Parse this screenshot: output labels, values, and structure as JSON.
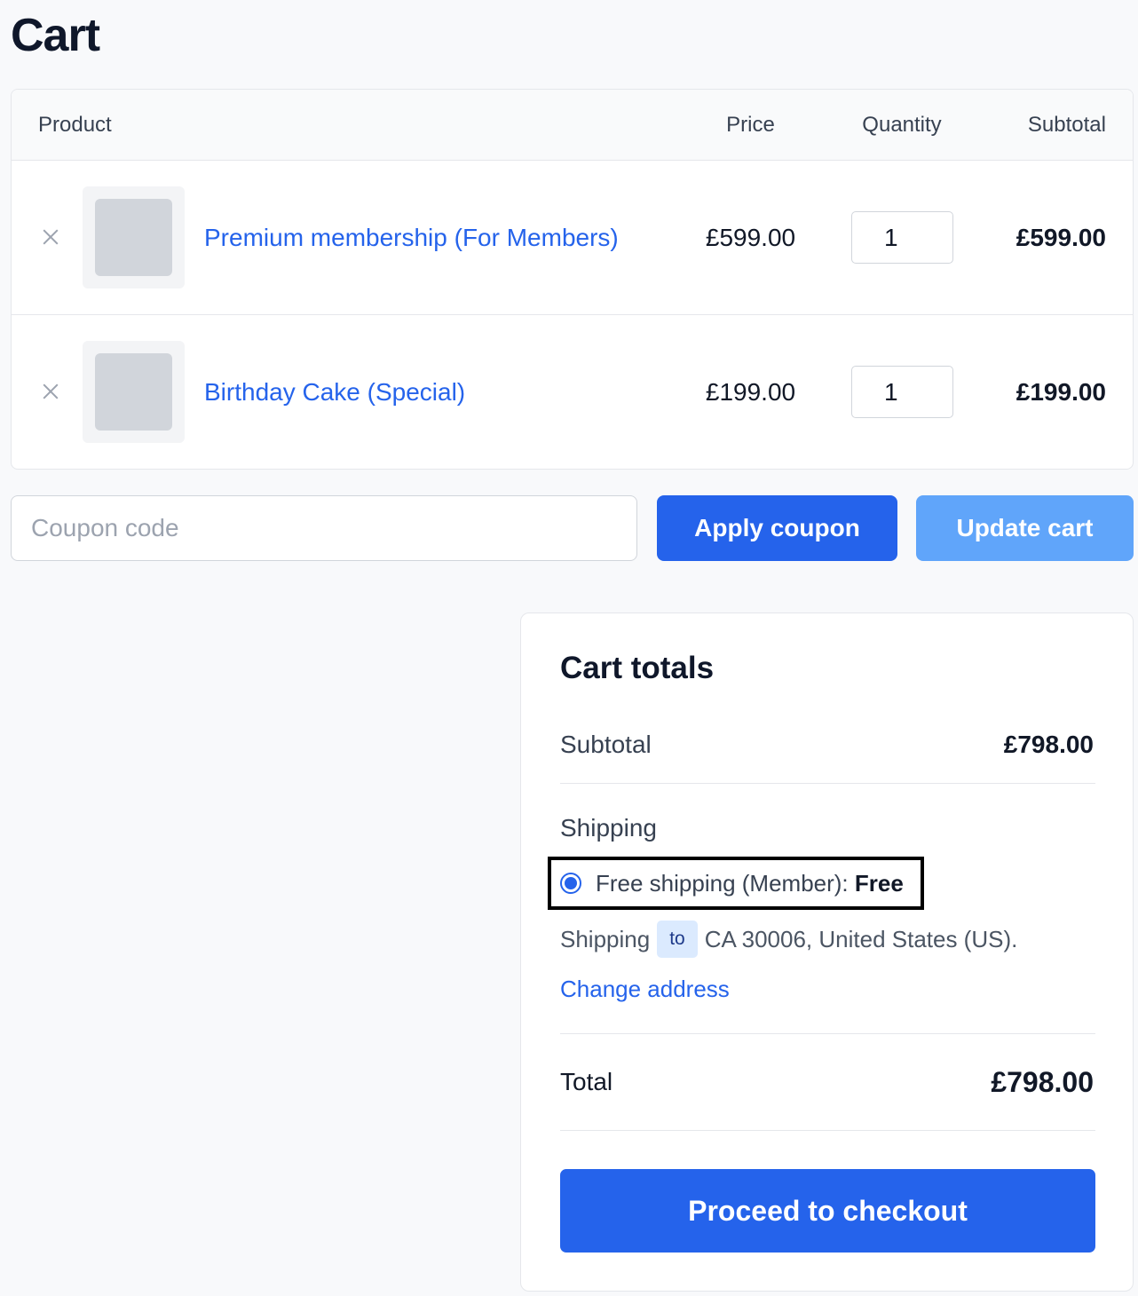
{
  "page": {
    "title": "Cart"
  },
  "table": {
    "headers": {
      "product": "Product",
      "price": "Price",
      "quantity": "Quantity",
      "subtotal": "Subtotal"
    },
    "rows": [
      {
        "product": "Premium membership (For Members)",
        "price": "£599.00",
        "quantity": "1",
        "subtotal": "£599.00"
      },
      {
        "product": "Birthday Cake (Special)",
        "price": "£199.00",
        "quantity": "1",
        "subtotal": "£199.00"
      }
    ]
  },
  "coupon": {
    "placeholder": "Coupon code",
    "apply_label": "Apply coupon",
    "update_label": "Update cart"
  },
  "totals": {
    "title": "Cart totals",
    "subtotal_label": "Subtotal",
    "subtotal_value": "£798.00",
    "shipping_label": "Shipping",
    "shipping_option": "Free shipping (Member): ",
    "shipping_option_value": "Free",
    "shipping_prefix": "Shipping",
    "shipping_to": "to",
    "shipping_address": "CA 30006, United States (US).",
    "change_address": "Change address",
    "total_label": "Total",
    "total_value": "£798.00",
    "checkout_label": "Proceed to checkout"
  },
  "colors": {
    "accent": "#2563eb",
    "accent_light": "#60a5fa"
  },
  "icons": {
    "remove": "close-icon",
    "radio": "radio-selected-icon"
  }
}
